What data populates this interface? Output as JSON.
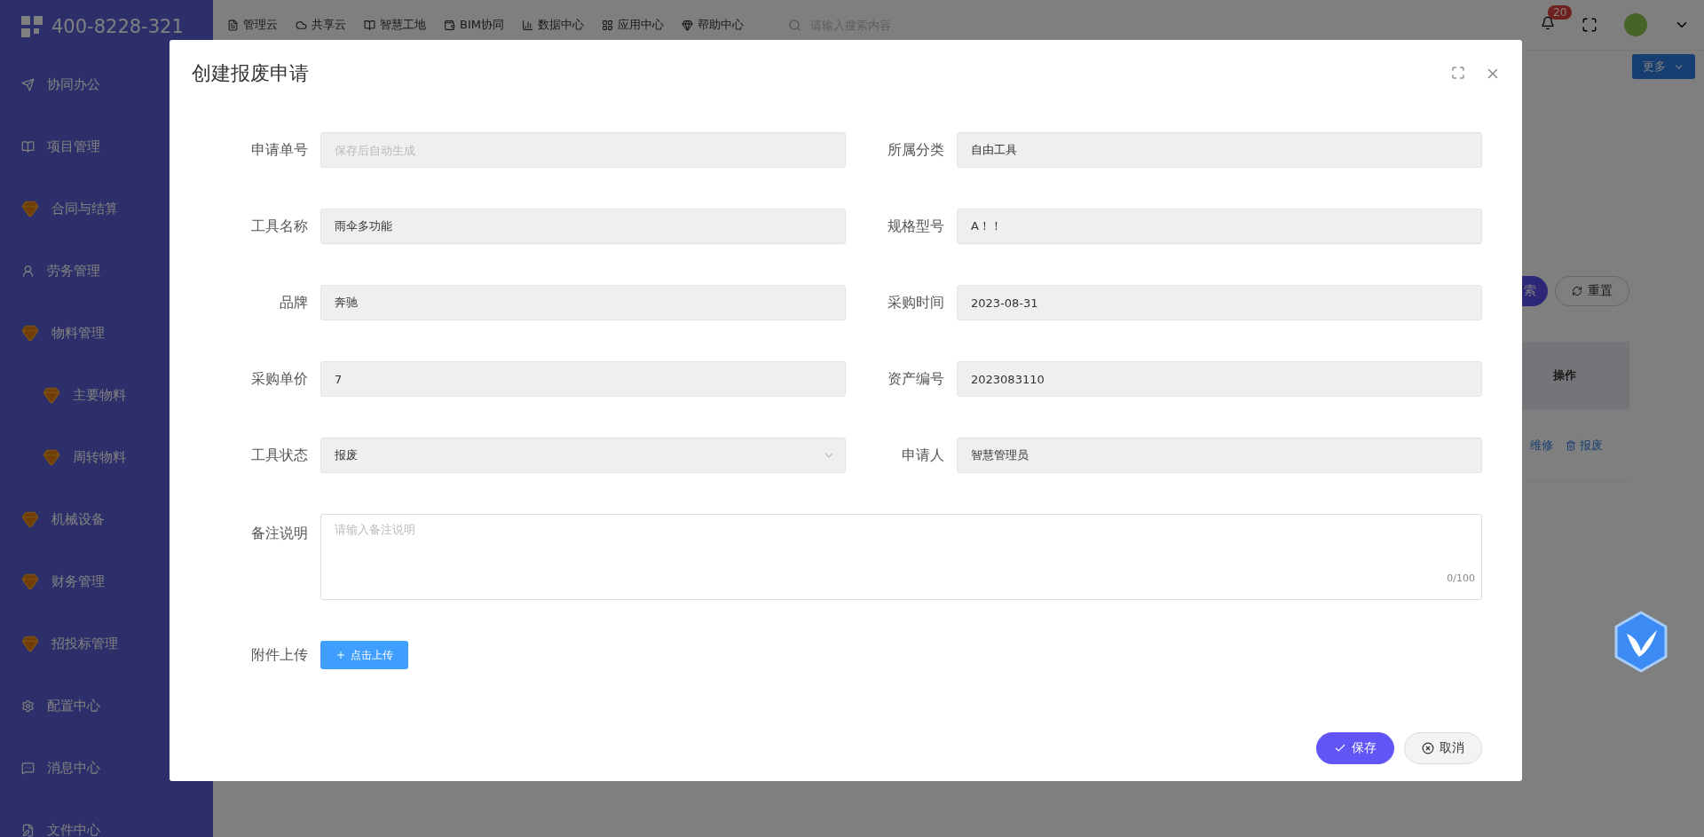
{
  "sidebar": {
    "logo": "400-8228-321",
    "items": [
      {
        "label": "协同办公",
        "kind": "send"
      },
      {
        "label": "项目管理",
        "kind": "book"
      },
      {
        "label": "合同与结算",
        "kind": "gem"
      },
      {
        "label": "劳务管理",
        "kind": "user"
      },
      {
        "label": "物料管理",
        "kind": "gem",
        "children": [
          {
            "label": "主要物料",
            "kind": "gem"
          },
          {
            "label": "周转物料",
            "kind": "gem"
          }
        ]
      },
      {
        "label": "机械设备",
        "kind": "gem"
      },
      {
        "label": "财务管理",
        "kind": "gem"
      },
      {
        "label": "招投标管理",
        "kind": "gem"
      },
      {
        "label": "配置中心",
        "kind": "gear"
      },
      {
        "label": "消息中心",
        "kind": "chat"
      },
      {
        "label": "文件中心",
        "kind": "edit"
      }
    ]
  },
  "topbar": {
    "nav": [
      {
        "label": "管理云",
        "kind": "doc"
      },
      {
        "label": "共享云",
        "kind": "cloud"
      },
      {
        "label": "智慧工地",
        "kind": "book"
      },
      {
        "label": "BIM协同",
        "kind": "wallet"
      },
      {
        "label": "数据中心",
        "kind": "chart"
      },
      {
        "label": "应用中心",
        "kind": "grid"
      },
      {
        "label": "帮助中心",
        "kind": "gem"
      }
    ],
    "search": {
      "placeholder": "请输入搜索内容"
    },
    "notifications": "20"
  },
  "page": {
    "more_button": "更多",
    "search_button": "索",
    "reset_button": "重置",
    "table": {
      "columns": [
        "操作"
      ],
      "rows": [
        {
          "actions": [
            "维修",
            "报废"
          ]
        }
      ]
    }
  },
  "dialog": {
    "title": "创建报废申请",
    "fields": [
      {
        "label": "申请单号",
        "placeholder": "保存后自动生成",
        "kind": "input"
      },
      {
        "label": "所属分类",
        "value": "自由工具",
        "kind": "input"
      },
      {
        "label": "工具名称",
        "value": "雨伞多功能",
        "kind": "input"
      },
      {
        "label": "规格型号",
        "value": "A！！",
        "kind": "input"
      },
      {
        "label": "品牌",
        "value": "奔驰",
        "kind": "input"
      },
      {
        "label": "采购时间",
        "value": "2023-08-31",
        "kind": "input"
      },
      {
        "label": "采购单价",
        "value": "7",
        "kind": "input"
      },
      {
        "label": "资产编号",
        "value": "2023083110",
        "kind": "input"
      },
      {
        "label": "工具状态",
        "value": "报废",
        "kind": "select"
      },
      {
        "label": "申请人",
        "value": "智慧管理员",
        "kind": "input"
      }
    ],
    "remark": {
      "label": "备注说明",
      "placeholder": "请输入备注说明",
      "counter": "0/100"
    },
    "upload": {
      "label": "附件上传",
      "button": "点击上传"
    },
    "buttons": [
      {
        "label": "保存",
        "kind": "primary"
      },
      {
        "label": "取消",
        "kind": "default"
      }
    ]
  }
}
